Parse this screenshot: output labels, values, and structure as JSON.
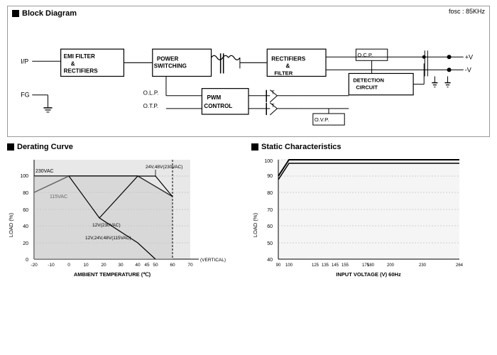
{
  "blockDiagram": {
    "title": "Block Diagram",
    "fosc": "fosc : 85KHz",
    "boxes": [
      {
        "id": "emi",
        "label": "EMI FILTER\n&\nRECTIFIERS"
      },
      {
        "id": "power",
        "label": "POWER\nSWITCHING"
      },
      {
        "id": "rect",
        "label": "RECTIFIERS\n&\nFILTER"
      },
      {
        "id": "pwm",
        "label": "PWM\nCONTROL"
      },
      {
        "id": "detection",
        "label": "DETECTION\nCIRCUIT"
      }
    ],
    "labels": {
      "ip": "I/P",
      "fg": "FG",
      "olp": "O.L.P.",
      "otp": "O.T.P.",
      "ocp": "O.C.P.",
      "ovp": "O.V.P.",
      "vpos": "+V",
      "vneg": "-V"
    }
  },
  "deratingCurve": {
    "title": "Derating Curve",
    "xLabel": "AMBIENT TEMPERATURE (℃)",
    "yLabel": "LOAD (%)",
    "xNote": "(VERTICAL)",
    "lines": [
      {
        "label": "230VAC",
        "type": "top"
      },
      {
        "label": "115VAC",
        "type": "mid"
      },
      {
        "label": "12V(230VAC)",
        "type": "mid2"
      },
      {
        "label": "24V,48V(230VAC)",
        "type": "right-top"
      },
      {
        "label": "12V,24V,48V(115VAC)",
        "type": "right-bot"
      }
    ],
    "xTicks": [
      "-20",
      "-10",
      "0",
      "10",
      "20",
      "30",
      "40",
      "45",
      "50",
      "60",
      "70"
    ],
    "yTicks": [
      "0",
      "20",
      "40",
      "60",
      "80",
      "100"
    ]
  },
  "staticCharacteristics": {
    "title": "Static Characteristics",
    "xLabel": "INPUT VOLTAGE (V) 60Hz",
    "yLabel": "LOAD (%)",
    "xTicks": [
      "90",
      "100",
      "125",
      "135",
      "145",
      "155",
      "175",
      "180",
      "200",
      "230",
      "264"
    ],
    "yTicks": [
      "40",
      "50",
      "60",
      "70",
      "80",
      "90",
      "100"
    ]
  }
}
